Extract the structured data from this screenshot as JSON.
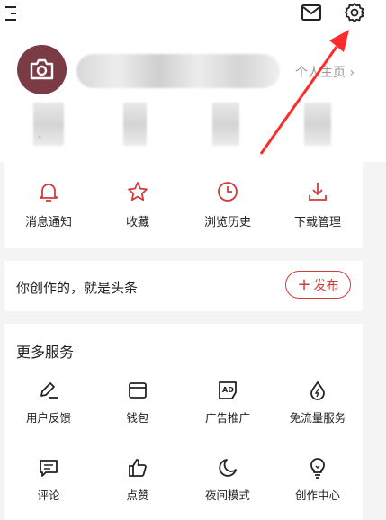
{
  "topbar": {
    "menu_icon": "menu-icon",
    "mail_icon": "mail-icon",
    "settings_icon": "gear-icon"
  },
  "profile": {
    "homepage_link": "个人主页 ›",
    "avatar_icon": "camera-icon"
  },
  "quick_actions": [
    {
      "label": "消息通知",
      "icon": "bell-icon"
    },
    {
      "label": "收藏",
      "icon": "star-icon"
    },
    {
      "label": "浏览历史",
      "icon": "clock-icon"
    },
    {
      "label": "下载管理",
      "icon": "download-icon"
    }
  ],
  "create_banner": {
    "text": "你创作的，就是头条",
    "publish_label": "发布",
    "publish_symbol": "+"
  },
  "services": {
    "title": "更多服务",
    "items": [
      {
        "label": "用户反馈",
        "icon": "feedback-pen-icon"
      },
      {
        "label": "钱包",
        "icon": "wallet-icon"
      },
      {
        "label": "广告推广",
        "icon": "ad-icon"
      },
      {
        "label": "免流量服务",
        "icon": "data-drop-icon"
      },
      {
        "label": "评论",
        "icon": "comment-icon"
      },
      {
        "label": "点赞",
        "icon": "thumbs-up-icon"
      },
      {
        "label": "夜间模式",
        "icon": "moon-icon"
      },
      {
        "label": "创作中心",
        "icon": "lightbulb-icon"
      }
    ]
  },
  "colors": {
    "accent": "#d23b3b",
    "annotation_arrow": "#ff2a2a",
    "avatar_bg": "#7a3b45"
  }
}
